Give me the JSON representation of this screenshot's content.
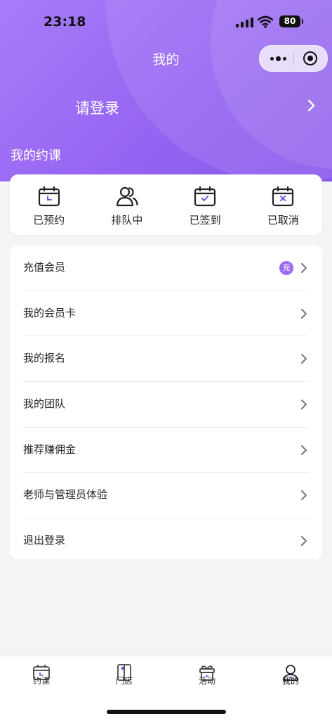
{
  "status_bar": {
    "time": "23:18",
    "battery": "80"
  },
  "header": {
    "title": "我的",
    "login_text": "请登录",
    "section_title": "我的约课"
  },
  "course_status": [
    {
      "label": "已预约",
      "icon": "calendar-clock-icon"
    },
    {
      "label": "排队中",
      "icon": "users-icon"
    },
    {
      "label": "已签到",
      "icon": "calendar-check-icon"
    },
    {
      "label": "已取消",
      "icon": "calendar-cancel-icon"
    }
  ],
  "menu": [
    {
      "label": "充值会员",
      "badge": "充"
    },
    {
      "label": "我的会员卡"
    },
    {
      "label": "我的报名"
    },
    {
      "label": "我的团队"
    },
    {
      "label": "推荐赚佣金"
    },
    {
      "label": "老师与管理员体验"
    },
    {
      "label": "退出登录"
    }
  ],
  "tabbar": [
    {
      "label": "约课",
      "icon": "calendar-icon"
    },
    {
      "label": "门店",
      "icon": "store-icon"
    },
    {
      "label": "活动",
      "icon": "gift-icon"
    },
    {
      "label": "我的",
      "icon": "user-icon",
      "active": true
    }
  ],
  "colors": {
    "accent": "#9664f2",
    "badge": "#9a6cf3",
    "background": "#f4f4f6"
  }
}
